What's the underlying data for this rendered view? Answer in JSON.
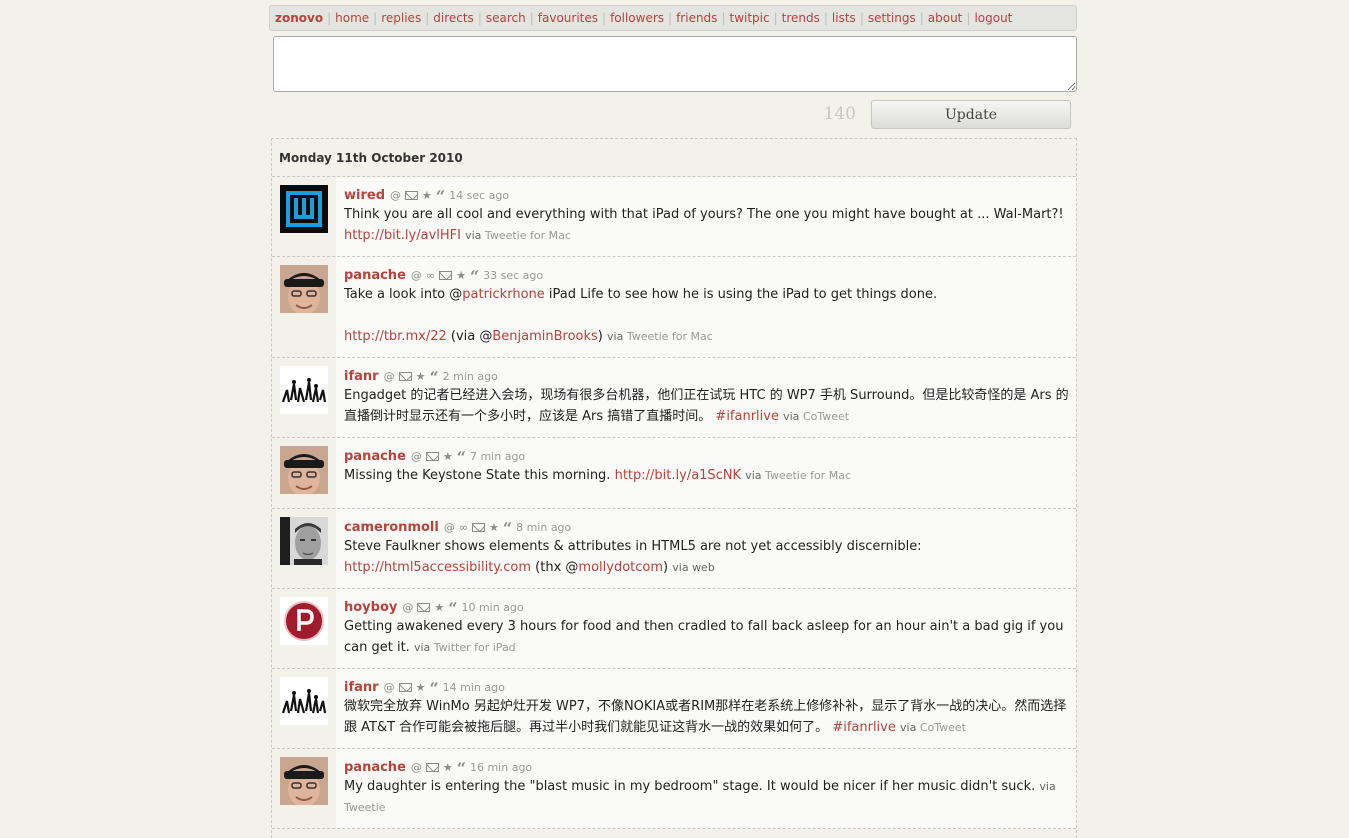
{
  "nav": {
    "brand": "zonovo",
    "items": [
      "home",
      "replies",
      "directs",
      "search",
      "favourites",
      "followers",
      "friends",
      "twitpic",
      "trends",
      "lists",
      "settings",
      "about",
      "logout"
    ]
  },
  "compose": {
    "counter": "140",
    "update_label": "Update",
    "value": ""
  },
  "timeline": {
    "date": "Monday 11th October 2010",
    "tweets": [
      {
        "user": "wired",
        "avatar": "wired",
        "icons": [
          "at",
          "mail",
          "star",
          "quote"
        ],
        "time": "14 sec ago",
        "text": "Think you are all cool and everything with that iPad of yours? The one you might have bought at ... Wal-Mart?!",
        "link": "http://bit.ly/avlHFI",
        "via": "via",
        "source": "Tweetie for Mac"
      },
      {
        "user": "panache",
        "avatar": "panache",
        "icons": [
          "at",
          "convo",
          "mail",
          "star",
          "quote"
        ],
        "time": "33 sec ago",
        "text_pre": "Take a look into @",
        "mention": "patrickrhone",
        "text_post": " iPad Life to see how he is using the iPad to get things done.",
        "link": "http://tbr.mx/22",
        "after_link": " (via @",
        "mention2": "BenjaminBrooks",
        "after_mention2": ")",
        "via": "via",
        "source": "Tweetie for Mac"
      },
      {
        "user": "ifanr",
        "avatar": "ifanr",
        "icons": [
          "at",
          "mail",
          "star",
          "quote"
        ],
        "time": "2 min ago",
        "text": "Engadget 的记者已经进入会场，现场有很多台机器，他们正在试玩 HTC 的 WP7 手机 Surround。但是比较奇怪的是 Ars 的直播倒计时显示还有一个多小时，应该是 Ars 搞错了直播时间。",
        "hashtag": "#ifanrlive",
        "via": "via",
        "source": "CoTweet"
      },
      {
        "user": "panache",
        "avatar": "panache",
        "icons": [
          "at",
          "mail",
          "star",
          "quote"
        ],
        "time": "7 min ago",
        "text": "Missing the Keystone State this morning.",
        "link": "http://bit.ly/a1ScNK",
        "via": "via",
        "source": "Tweetie for Mac"
      },
      {
        "user": "cameronmoll",
        "avatar": "cameronmoll",
        "icons": [
          "at",
          "convo",
          "mail",
          "star",
          "quote"
        ],
        "time": "8 min ago",
        "text": "Steve Faulkner shows elements & attributes in HTML5 are not yet accessibly discernible:",
        "link": "http://html5accessibility.com",
        "after_link": " (thx @",
        "mention2": "mollydotcom",
        "after_mention2": ")",
        "via": "via",
        "source": "web"
      },
      {
        "user": "hoyboy",
        "avatar": "hoyboy",
        "icons": [
          "at",
          "mail",
          "star",
          "quote"
        ],
        "time": "10 min ago",
        "text": "Getting awakened every 3 hours for food and then cradled to fall back asleep for an hour ain't a bad gig if you can get it.",
        "via": "via",
        "source": "Twitter for iPad"
      },
      {
        "user": "ifanr",
        "avatar": "ifanr",
        "icons": [
          "at",
          "mail",
          "star",
          "quote"
        ],
        "time": "14 min ago",
        "text": "微软完全放弃 WinMo 另起炉灶开发 WP7，不像NOKIA或者RIM那样在老系统上修修补补，显示了背水一战的决心。然而选择跟 AT&T 合作可能会被拖后腿。再过半小时我们就能见证这背水一战的效果如何了。",
        "hashtag": "#ifanrlive",
        "via": "via",
        "source": "CoTweet"
      },
      {
        "user": "panache",
        "avatar": "panache",
        "icons": [
          "at",
          "mail",
          "star",
          "quote"
        ],
        "time": "16 min ago",
        "text": "My daughter is entering the \"blast music in my bedroom\" stage. It would be nicer if her music didn't suck.",
        "via": "via",
        "source": "Tweetie"
      }
    ]
  },
  "colors": {
    "link": "#b5443a",
    "background": "#f3f2ea",
    "tweet_bg": "#fafaf9"
  }
}
